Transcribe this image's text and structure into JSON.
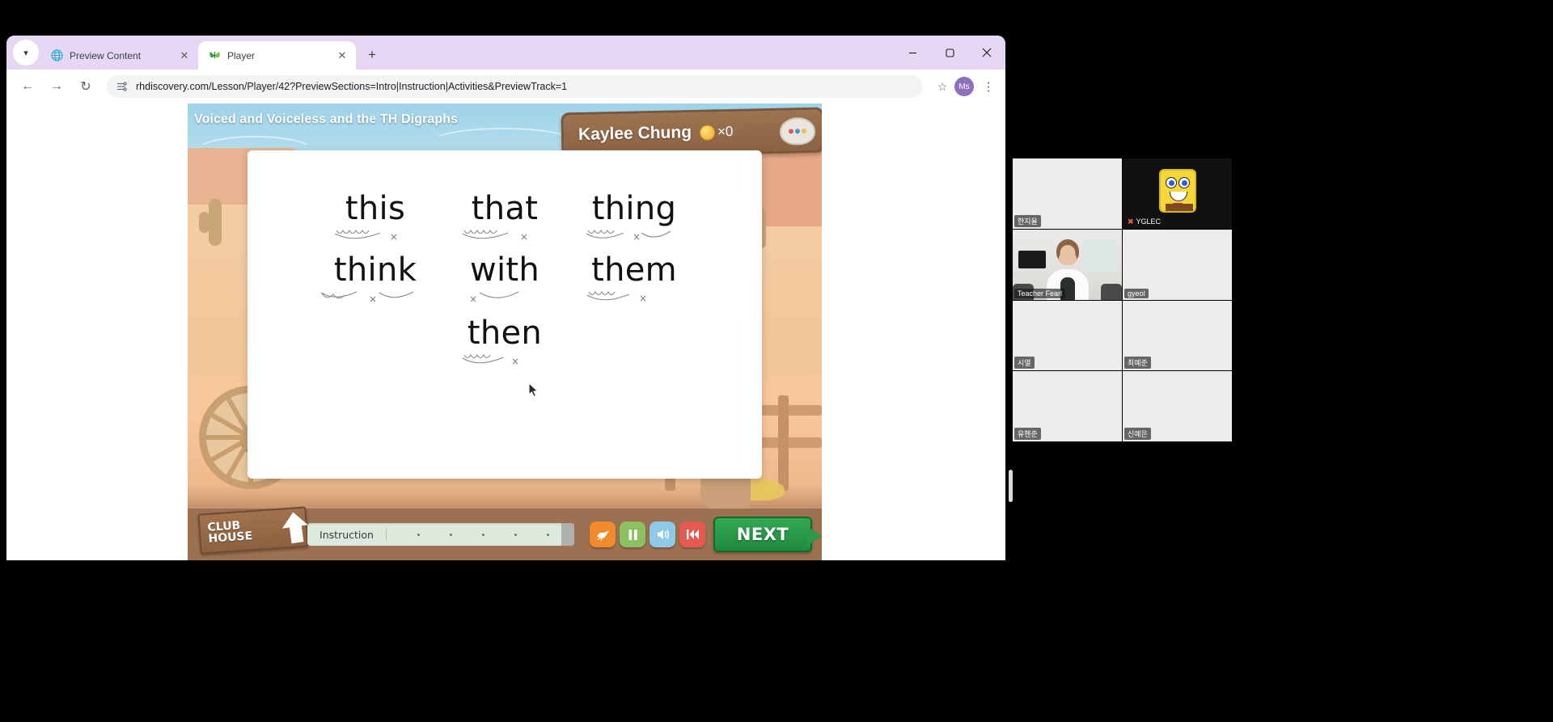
{
  "browser": {
    "tab_list_icon": "chevron-down-icon",
    "tabs": [
      {
        "title": "Preview Content",
        "favicon": "globe-icon",
        "active": false,
        "close_label": "✕"
      },
      {
        "title": "Player",
        "favicon": "butterfly-icon",
        "active": true,
        "close_label": "✕"
      }
    ],
    "new_tab_label": "+",
    "window_controls": {
      "minimize": "—",
      "maximize": "❐",
      "close": "✕"
    },
    "nav": {
      "back": "←",
      "forward": "→",
      "reload": "↻"
    },
    "omnibox": {
      "prefix_icon": "site-settings-icon",
      "url": "rhdiscovery.com/Lesson/Player/42?PreviewSections=Intro|Instruction|Activities&PreviewTrack=1",
      "bookmark_icon": "☆"
    },
    "profile_initial": "Ms",
    "menu_icon": "⋮"
  },
  "lesson": {
    "title": "Voiced and Voiceless and the TH Digraphs",
    "student_name": "Kaylee Chung",
    "coin_icon": "coin-icon",
    "coin_count": "×0",
    "palette_icon": "paint-palette-icon",
    "words": [
      [
        {
          "text": "this",
          "voiced": true,
          "mark": "×"
        },
        {
          "text": "that",
          "voiced": true,
          "mark": "×"
        },
        {
          "text": "thing",
          "voiced": false,
          "mark": "×"
        }
      ],
      [
        {
          "text": "think",
          "voiced": false,
          "mark": "×"
        },
        {
          "text": "with",
          "voiced": true,
          "mark": "×"
        },
        {
          "text": "them",
          "voiced": true,
          "mark": "×"
        }
      ],
      [
        {
          "text": "then",
          "voiced": true,
          "mark": "×"
        }
      ]
    ],
    "toolbar": {
      "clubhouse_line1": "CLUB",
      "clubhouse_line2": "HOUSE",
      "clubhouse_arrow_icon": "up-arrow-icon",
      "section_label": "Instruction",
      "progress_dots": 5,
      "controls": [
        {
          "name": "skip-button",
          "icon": "bird-skip-icon",
          "color": "#f08a2a",
          "glyph": "✈"
        },
        {
          "name": "pause-button",
          "icon": "pause-icon",
          "color": "#8cc063",
          "glyph": "▐▐"
        },
        {
          "name": "sound-button",
          "icon": "speaker-icon",
          "color": "#8fc9e8",
          "glyph": "🔊"
        },
        {
          "name": "rewind-button",
          "icon": "rewind-icon",
          "color": "#e45a50",
          "glyph": "⏮"
        }
      ],
      "next_label": "NEXT",
      "next_arrow_icon": "right-arrow-icon"
    }
  },
  "video_panel": {
    "participants": [
      {
        "name": "한지율",
        "kind": "camera-off",
        "muted": false,
        "selected": false
      },
      {
        "name": "YGLEC",
        "kind": "avatar-spongebob",
        "muted": true,
        "selected": false
      },
      {
        "name": "Teacher Fearl",
        "kind": "camera-on",
        "muted": false,
        "selected": true
      },
      {
        "name": "gyeol",
        "kind": "camera-off",
        "muted": false,
        "selected": false
      },
      {
        "name": "시열",
        "kind": "camera-off",
        "muted": false,
        "selected": false
      },
      {
        "name": "최예준",
        "kind": "camera-off",
        "muted": false,
        "selected": false
      },
      {
        "name": "유헨준",
        "kind": "camera-off",
        "muted": false,
        "selected": false
      },
      {
        "name": "신예은",
        "kind": "camera-off",
        "muted": false,
        "selected": false
      }
    ]
  }
}
